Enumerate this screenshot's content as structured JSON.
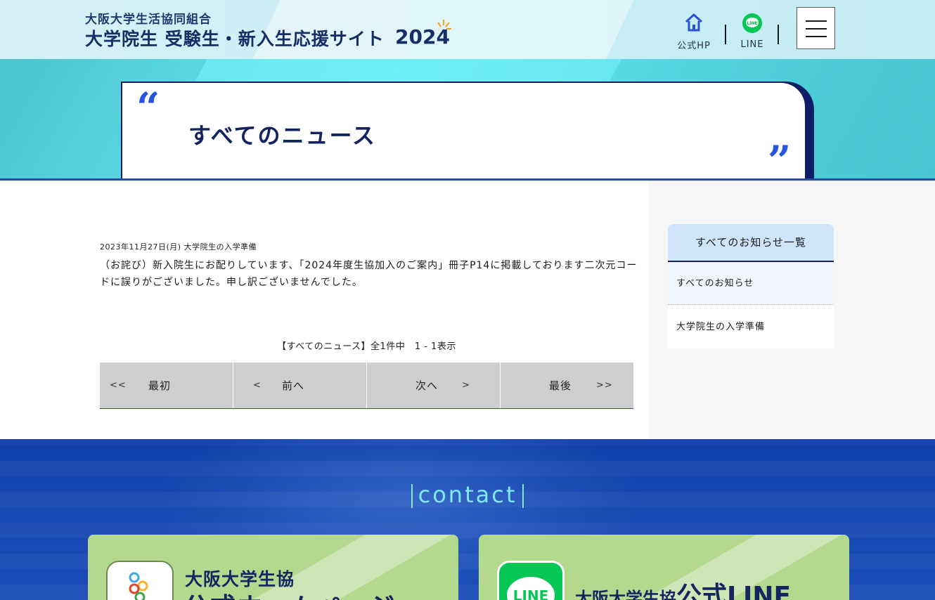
{
  "header": {
    "brand_top": "大阪大学生活協同組合",
    "brand_main": "大学院生 受験生・新入生応援サイト",
    "brand_year": "2024",
    "hp_label": "公式HP",
    "line_label": "LINE",
    "hp_icon": "home-icon",
    "line_icon": "line-icon",
    "menu_icon": "hamburger-menu-icon"
  },
  "hero": {
    "title": "すべてのニュース",
    "quote_open": "“",
    "quote_close": "”"
  },
  "news": {
    "meta": "2023年11月27日(月) 大学院生の入学準備",
    "title": "（お詫び）新入院生にお配りしています、「2024年度生協加入のご案内」冊子P14に掲載しております二次元コードに誤りがございました。申し訳ございませんでした。",
    "count": "【すべてのニュース】全1件中　1 - 1表示"
  },
  "pager": {
    "first_arrow": "<<",
    "first_label": "最初",
    "prev_arrow": "<",
    "prev_label": "前へ",
    "next_label": "次へ",
    "next_arrow": ">",
    "last_label": "最後",
    "last_arrow": ">>"
  },
  "sidebar": {
    "heading": "すべてのお知らせ一覧",
    "items": [
      {
        "label": "すべてのお知らせ"
      },
      {
        "label": "大学院生の入学準備"
      }
    ]
  },
  "contact": {
    "title": "contact",
    "hp_card_line1": "大阪大学生協",
    "hp_card_line2": "公式ホームページ",
    "line_card_small": "大阪大学生協",
    "line_card_big": "公式LINE",
    "line_icon_text": "LINE"
  },
  "colors": {
    "navy": "#13235f",
    "accent_blue": "#2855e0",
    "hero_cyan": "#5fe8f0",
    "card_green": "#b3d98e",
    "line_green": "#06c755"
  }
}
